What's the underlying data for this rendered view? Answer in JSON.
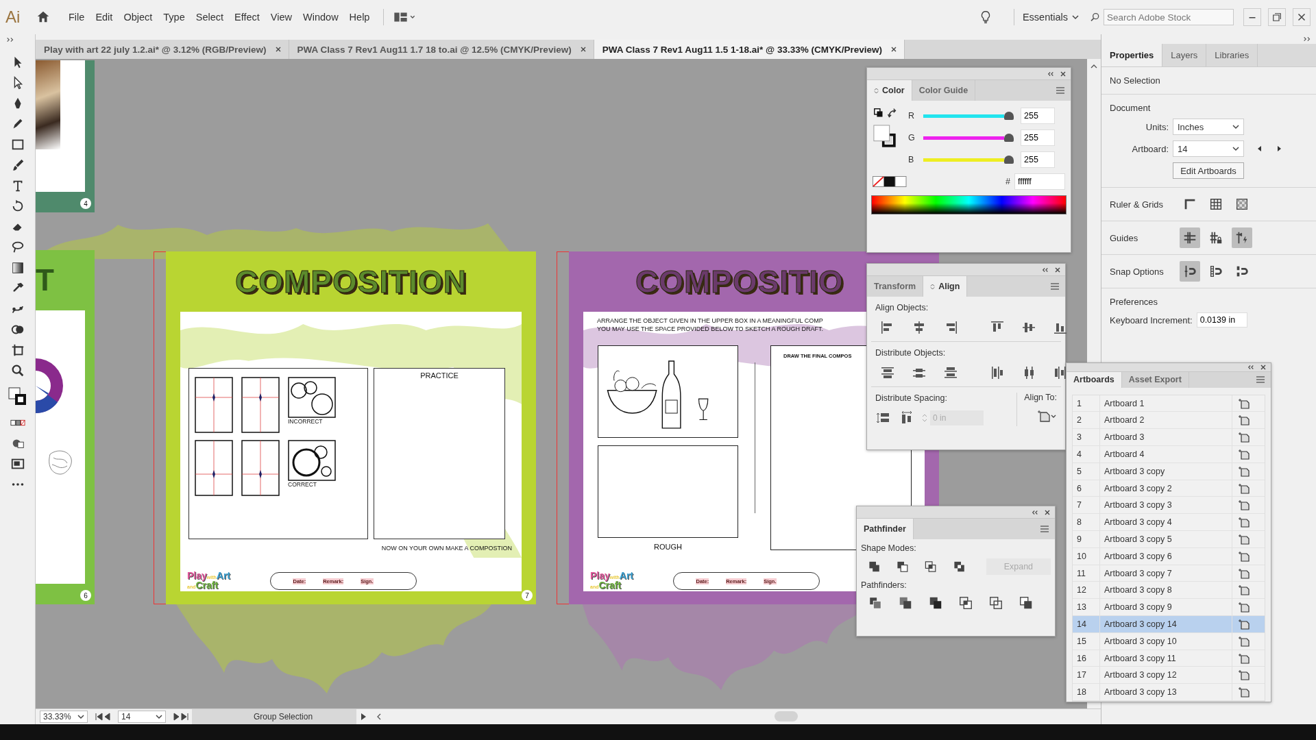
{
  "menu_bar": {
    "logo": "Ai",
    "menus": [
      "File",
      "Edit",
      "Object",
      "Type",
      "Select",
      "Effect",
      "View",
      "Window",
      "Help"
    ],
    "workspace": "Essentials",
    "search": {
      "placeholder": "Search Adobe Stock"
    }
  },
  "doc_tabs": [
    {
      "label": "Play with art 22 july 1.2.ai* @ 3.12% (RGB/Preview)",
      "selected": false
    },
    {
      "label": "PWA Class 7 Rev1 Aug11 1.7 18 to.ai @ 12.5% (CMYK/Preview)",
      "selected": false
    },
    {
      "label": "PWA Class 7 Rev1 Aug11 1.5 1-18.ai* @ 33.33% (CMYK/Preview)",
      "selected": true
    }
  ],
  "canvas": {
    "artboards": [
      {
        "kind": "partial-top",
        "color": "#4f8a6c",
        "number": "4"
      },
      {
        "kind": "partial-left",
        "color": "#7ec143",
        "heading": "T",
        "number": "6"
      },
      {
        "kind": "practice",
        "color": "#b9d532",
        "title": "COMPOSITION",
        "practice_label": "PRACTICE",
        "incorrect_label": "INCORRECT",
        "correct_label": "CORRECT",
        "caption": "NOW ON YOUR OWN MAKE A COMPOSTION",
        "logo": [
          {
            "text": "Play",
            "color": "#e0559a"
          },
          {
            "text": "with",
            "color": "#e8c93a"
          },
          {
            "text": "Art",
            "color": "#3a9fd0"
          },
          {
            "text": "and",
            "color": "#e8c93a"
          },
          {
            "text": "Craft",
            "color": "#6aae3b"
          }
        ],
        "footer": [
          "Date:",
          "Remark:",
          "Sign."
        ],
        "number": "7"
      },
      {
        "kind": "arrange",
        "color": "#a367ad",
        "title": "COMPOSITIO",
        "instructions": [
          "ARRANGE THE OBJECT GIVEN IN THE UPPER BOX IN A MEANINGFUL COMP",
          "YOU MAY USE THE SPACE PROVIDED BELOW TO SKETCH A ROUGH DRAFT."
        ],
        "final_label": "DRAW THE FINAL COMPOS",
        "rough_label": "ROUGH",
        "logo": [
          {
            "text": "Play",
            "color": "#e0559a"
          },
          {
            "text": "with",
            "color": "#e8c93a"
          },
          {
            "text": "Art",
            "color": "#3a9fd0"
          },
          {
            "text": "and",
            "color": "#e8c93a"
          },
          {
            "text": "Craft",
            "color": "#6aae3b"
          }
        ],
        "footer": [
          "Date:",
          "Remark:",
          "Sign."
        ]
      }
    ]
  },
  "color_panel": {
    "tabs": [
      {
        "label": "Color",
        "selected": true
      },
      {
        "label": "Color Guide",
        "selected": false
      }
    ],
    "channels": [
      {
        "name": "R",
        "color": "#22e4ee",
        "level": 1,
        "reading": "255"
      },
      {
        "name": "G",
        "color": "#ee22ee",
        "level": 1,
        "reading": "255"
      },
      {
        "name": "B",
        "color": "#eeee22",
        "level": 1,
        "reading": "255"
      }
    ],
    "hex_label": "#",
    "hex": "ffffff"
  },
  "align_panel": {
    "tabs": [
      {
        "label": "Transform",
        "selected": false
      },
      {
        "label": "Align",
        "selected": true
      }
    ],
    "align_objects": "Align Objects:",
    "distribute_objects": "Distribute Objects:",
    "distribute_spacing": "Distribute Spacing:",
    "spacing": {
      "value": "0 in",
      "disabled": true
    },
    "align_to": "Align To:"
  },
  "pathfinder_panel": {
    "tabs": [
      {
        "label": "Pathfinder",
        "selected": true
      }
    ],
    "shape_modes": "Shape Modes:",
    "expand": {
      "label": "Expand",
      "disabled": true
    },
    "pathfinders": "Pathfinders:"
  },
  "properties": {
    "tabs": [
      {
        "label": "Properties",
        "selected": true
      },
      {
        "label": "Layers",
        "selected": false
      },
      {
        "label": "Libraries",
        "selected": false
      }
    ],
    "selection": "No Selection",
    "document": "Document",
    "units_label": "Units:",
    "units": "Inches",
    "artboard_label": "Artboard:",
    "artboard": "14",
    "edit_button": "Edit Artboards",
    "sections": [
      {
        "label": "Ruler & Grids",
        "kind": "ruler",
        "buttons": [
          {
            "on": false
          },
          {
            "on": false
          },
          {
            "on": false
          }
        ]
      },
      {
        "label": "Guides",
        "kind": "guides",
        "buttons": [
          {
            "on": true
          },
          {
            "on": false
          },
          {
            "on": true
          }
        ]
      },
      {
        "label": "Snap Options",
        "kind": "snap",
        "buttons": [
          {
            "on": true
          },
          {
            "on": false
          },
          {
            "on": false
          }
        ]
      }
    ],
    "preferences": "Preferences",
    "increment_label": "Keyboard Increment:",
    "increment": "0.0139 in"
  },
  "artboards_panel": {
    "tabs": [
      {
        "label": "Artboards",
        "selected": true
      },
      {
        "label": "Asset Export",
        "selected": false
      }
    ],
    "rows": [
      {
        "number": "1",
        "name": "Artboard 1",
        "selected": false
      },
      {
        "number": "2",
        "name": "Artboard 2",
        "selected": false
      },
      {
        "number": "3",
        "name": "Artboard 3",
        "selected": false
      },
      {
        "number": "4",
        "name": "Artboard 4",
        "selected": false
      },
      {
        "number": "5",
        "name": "Artboard 3 copy",
        "selected": false
      },
      {
        "number": "6",
        "name": "Artboard 3 copy 2",
        "selected": false
      },
      {
        "number": "7",
        "name": "Artboard 3 copy 3",
        "selected": false
      },
      {
        "number": "8",
        "name": "Artboard 3 copy 4",
        "selected": false
      },
      {
        "number": "9",
        "name": "Artboard 3 copy 5",
        "selected": false
      },
      {
        "number": "10",
        "name": "Artboard 3 copy 6",
        "selected": false
      },
      {
        "number": "11",
        "name": "Artboard 3 copy 7",
        "selected": false
      },
      {
        "number": "12",
        "name": "Artboard 3 copy 8",
        "selected": false
      },
      {
        "number": "13",
        "name": "Artboard 3 copy 9",
        "selected": false
      },
      {
        "number": "14",
        "name": "Artboard 3 copy 14",
        "selected": true
      },
      {
        "number": "15",
        "name": "Artboard 3 copy 10",
        "selected": false
      },
      {
        "number": "16",
        "name": "Artboard 3 copy 11",
        "selected": false
      },
      {
        "number": "17",
        "name": "Artboard 3 copy 12",
        "selected": false
      },
      {
        "number": "18",
        "name": "Artboard 3 copy 13",
        "selected": false
      }
    ]
  },
  "status_bar": {
    "zoom": "33.33%",
    "artboard": "14",
    "tool": "Group Selection"
  }
}
